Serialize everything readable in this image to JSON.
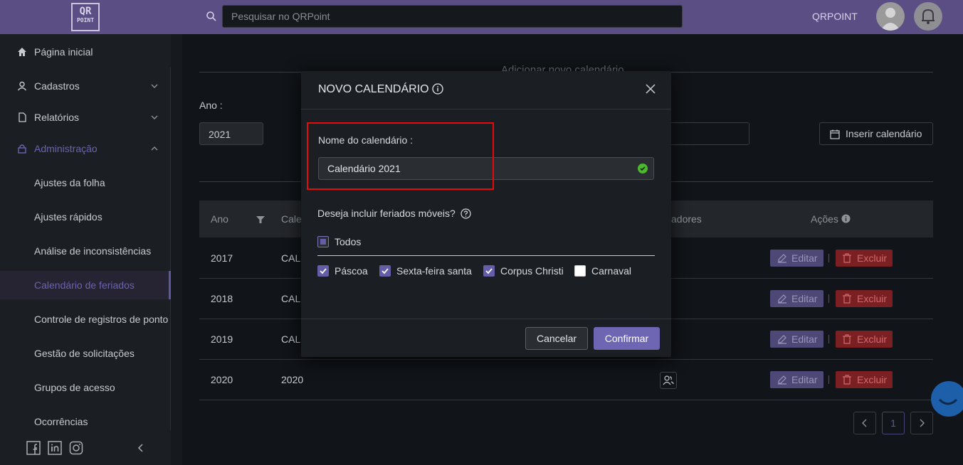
{
  "header": {
    "logo_top": "QR",
    "logo_bottom": "POINT",
    "search_placeholder": "Pesquisar no QRPoint",
    "company": "QRPOINT"
  },
  "sidebar": {
    "items": [
      {
        "label": "Página inicial",
        "icon": "home-icon"
      },
      {
        "label": "Cadastros",
        "icon": "user-icon"
      },
      {
        "label": "Relatórios",
        "icon": "file-icon"
      },
      {
        "label": "Administração",
        "icon": "lock-icon"
      }
    ],
    "sub_items": [
      {
        "label": "Ajustes da folha"
      },
      {
        "label": "Ajustes rápidos"
      },
      {
        "label": "Análise de inconsistências"
      },
      {
        "label": "Calendário de feriados",
        "active": true
      },
      {
        "label": "Controle de registros de ponto"
      },
      {
        "label": "Gestão de solicitações"
      },
      {
        "label": "Grupos de acesso"
      },
      {
        "label": "Ocorrências"
      }
    ]
  },
  "page": {
    "faded_title": "Adicionar novo calendário",
    "year_label": "Ano :",
    "year_value": "2021",
    "insert_button": "Inserir calendário"
  },
  "table": {
    "headers": [
      "Ano",
      "Cale",
      "adores",
      "Ações"
    ],
    "rows": [
      {
        "ano": "2017",
        "cal": "CAL"
      },
      {
        "ano": "2018",
        "cal": "CAL"
      },
      {
        "ano": "2019",
        "cal": "CAL"
      },
      {
        "ano": "2020",
        "cal": "2020"
      }
    ],
    "edit_label": "Editar",
    "delete_label": "Excluir"
  },
  "pagination": {
    "current": "1"
  },
  "modal": {
    "title": "NOVO CALENDÁRIO",
    "name_label": "Nome do calendário :",
    "name_value": "Calendário 2021",
    "question": "Deseja incluir feriados móveis?",
    "all_label": "Todos",
    "options": [
      {
        "label": "Páscoa",
        "checked": true
      },
      {
        "label": "Sexta-feira santa",
        "checked": true
      },
      {
        "label": "Corpus Christi",
        "checked": true
      },
      {
        "label": "Carnaval",
        "checked": false
      }
    ],
    "cancel": "Cancelar",
    "confirm": "Confirmar"
  },
  "colors": {
    "header": "#5a4e85",
    "accent": "#6e66b3",
    "danger": "#7a1f22",
    "highlight": "#e30b0b",
    "valid": "#4cb82c"
  }
}
